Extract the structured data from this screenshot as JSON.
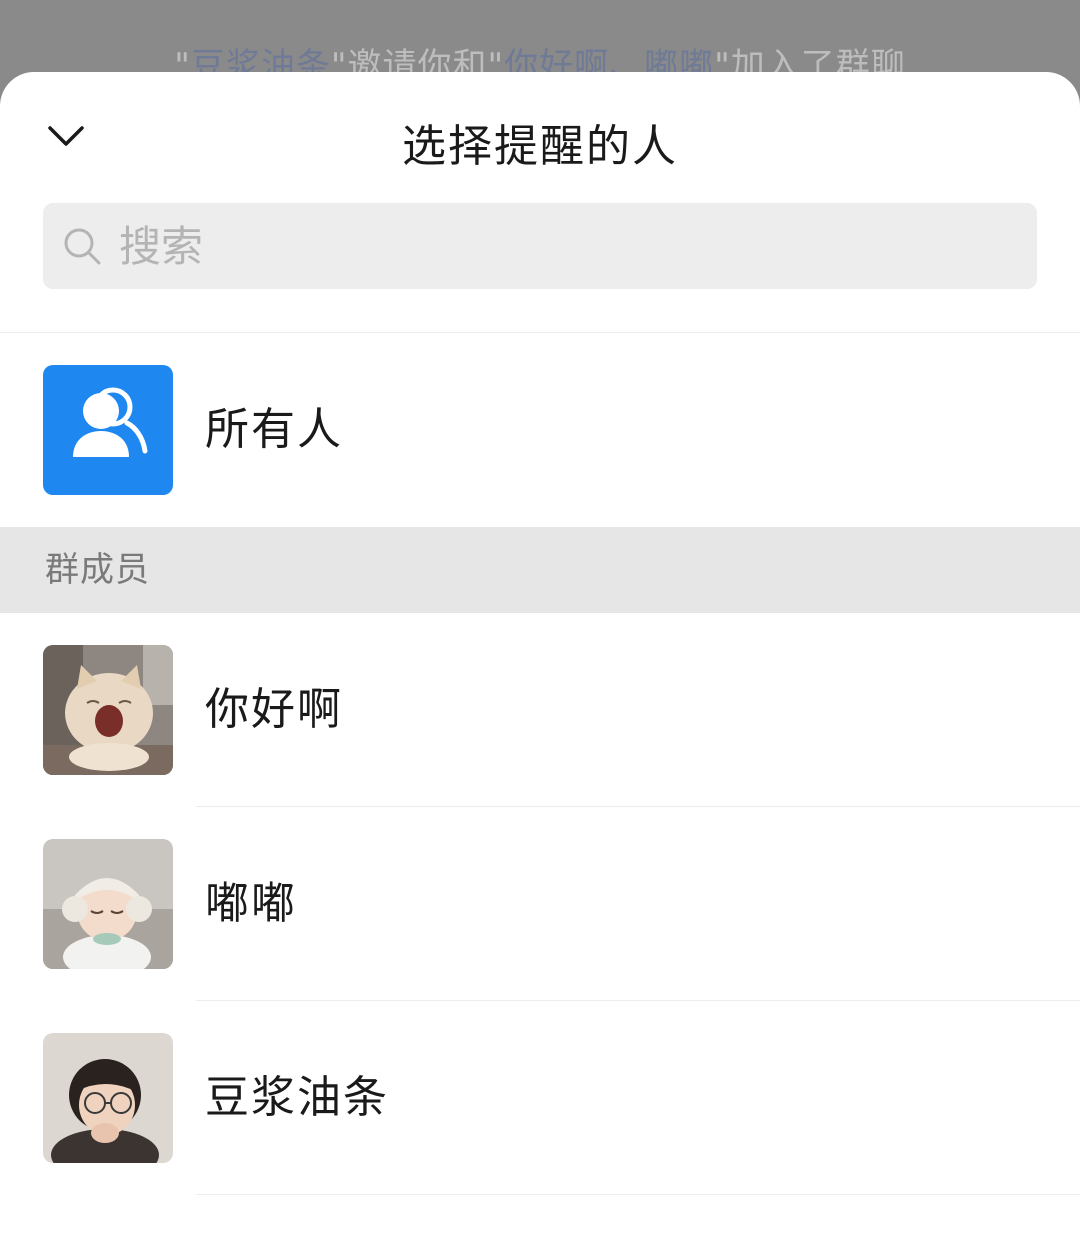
{
  "background": {
    "message_parts": [
      "\"",
      "豆浆油条",
      "\"邀请你和\"",
      "你好啊、嘟嘟",
      "\"加入了群聊"
    ]
  },
  "sheet": {
    "title": "选择提醒的人",
    "back_icon": "chevron-down-icon",
    "search": {
      "icon": "search-icon",
      "placeholder": "搜索",
      "value": ""
    },
    "everyone": {
      "label": "所有人",
      "icon": "group-users-icon",
      "color": "#1e88f0"
    },
    "section_label": "群成员",
    "members": [
      {
        "name": "你好啊",
        "avatar": "cat-yawning-photo"
      },
      {
        "name": "嘟嘟",
        "avatar": "child-earmuffs-photo"
      },
      {
        "name": "豆浆油条",
        "avatar": "child-glasses-photo"
      }
    ]
  }
}
